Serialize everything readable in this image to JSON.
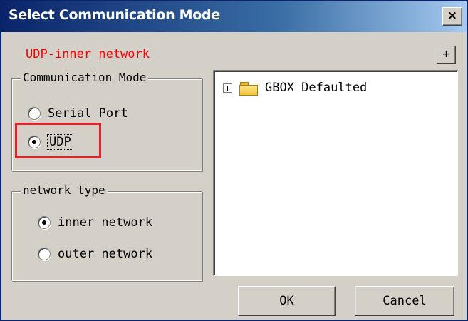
{
  "window": {
    "title": "Select Communication Mode",
    "close_label": "×"
  },
  "status": {
    "text": "UDP-inner network",
    "color": "#ff0000"
  },
  "expand_button": {
    "label": "+"
  },
  "communication_mode": {
    "legend": "Communication Mode",
    "options": [
      {
        "label": "Serial Port",
        "checked": false
      },
      {
        "label": "UDP",
        "checked": true
      }
    ]
  },
  "network_type": {
    "legend": "network type",
    "options": [
      {
        "label": "inner network",
        "checked": true
      },
      {
        "label": "outer network",
        "checked": false
      }
    ]
  },
  "device_tree": {
    "items": [
      {
        "label": "GBOX Defaulted",
        "icon": "folder-icon",
        "expanded": false
      }
    ]
  },
  "buttons": {
    "ok_label": "OK",
    "cancel_label": "Cancel"
  },
  "colors": {
    "titlebar_start": "#0a246a",
    "titlebar_end": "#a6caf0",
    "dialog_bg": "#d4d0c8",
    "highlight_box": "#e3212b"
  }
}
